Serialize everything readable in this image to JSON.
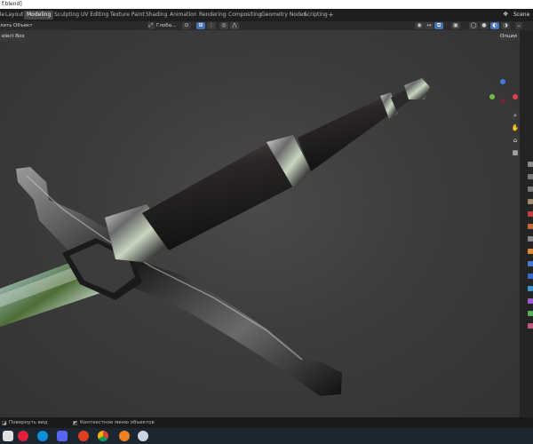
{
  "titlebar": {
    "title": "f.blend]"
  },
  "workspace_tabs": [
    {
      "label": "File",
      "active": false
    },
    {
      "label": "Layout",
      "active": false
    },
    {
      "label": "Modeling",
      "active": true
    },
    {
      "label": "Sculpting",
      "active": false
    },
    {
      "label": "UV Editing",
      "active": false
    },
    {
      "label": "Texture Paint",
      "active": false
    },
    {
      "label": "Shading",
      "active": false
    },
    {
      "label": "Animation",
      "active": false
    },
    {
      "label": "Rendering",
      "active": false
    },
    {
      "label": "Compositing",
      "active": false
    },
    {
      "label": "Geometry Nodes",
      "active": false
    },
    {
      "label": "Scripting",
      "active": false
    }
  ],
  "add_workspace": "+",
  "scene": {
    "label": "Scene"
  },
  "viewport_header": {
    "menu_1": "лить",
    "menu_2": "Объект",
    "orientation": "Глоба...",
    "options_label": "Опции"
  },
  "tool": {
    "select_label": "elect Box"
  },
  "status_bar": {
    "left": "Повернуть вид",
    "middle": "Контекстное меню объектов"
  },
  "gizmo": {
    "x_color": "#e0404a",
    "y_color": "#6fbd3a",
    "z_color": "#3d7bd8"
  },
  "accent_color": "#4772b3",
  "taskbar_icons": [
    "windows-start-icon",
    "opera-icon",
    "skype-icon",
    "discord-icon",
    "media-player-icon",
    "chrome-icon",
    "blender-icon",
    "app-icon"
  ]
}
